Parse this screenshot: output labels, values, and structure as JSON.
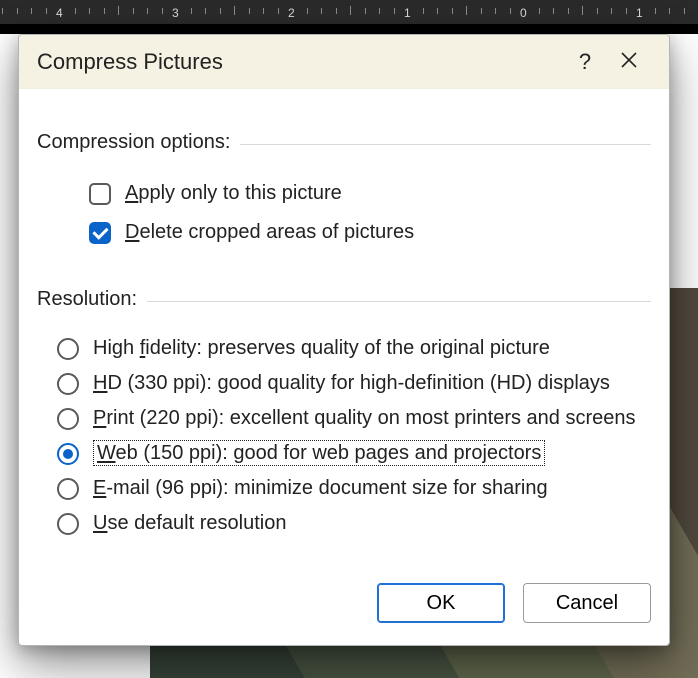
{
  "ruler": {
    "labels": [
      "4",
      "3",
      "2",
      "1",
      "0",
      "1"
    ]
  },
  "dialog": {
    "title": "Compress Pictures",
    "help_tooltip": "?",
    "sections": {
      "compression_label": "Compression options:",
      "resolution_label": "Resolution:"
    },
    "options": {
      "apply_only": {
        "label_pre": "",
        "accel": "A",
        "label_post": "pply only to this picture",
        "checked": false
      },
      "delete_cropped": {
        "label_pre": "",
        "accel": "D",
        "label_post": "elete cropped areas of pictures",
        "checked": true
      }
    },
    "resolutions": [
      {
        "id": "high",
        "accel_pre": "High ",
        "accel": "f",
        "post": "idelity: preserves quality of the original picture",
        "selected": false
      },
      {
        "id": "hd",
        "accel_pre": "",
        "accel": "H",
        "post": "D (330 ppi): good quality for high-definition (HD) displays",
        "selected": false
      },
      {
        "id": "print",
        "accel_pre": "",
        "accel": "P",
        "post": "rint (220 ppi): excellent quality on most printers and screens",
        "selected": false
      },
      {
        "id": "web",
        "accel_pre": "",
        "accel": "W",
        "post": "eb (150 ppi): good for web pages and projectors",
        "selected": true
      },
      {
        "id": "email",
        "accel_pre": "",
        "accel": "E",
        "post": "-mail (96 ppi): minimize document size for sharing",
        "selected": false
      },
      {
        "id": "default",
        "accel_pre": "",
        "accel": "U",
        "post": "se default resolution",
        "selected": false
      }
    ],
    "buttons": {
      "ok": "OK",
      "cancel": "Cancel"
    }
  }
}
